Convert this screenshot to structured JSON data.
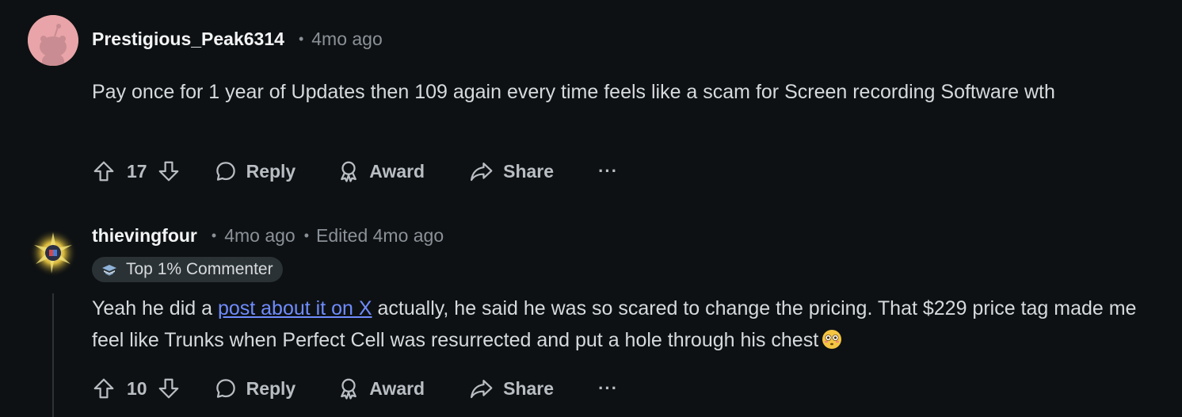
{
  "comments": [
    {
      "username": "Prestigious_Peak6314",
      "time": "4mo ago",
      "body": "Pay once for 1 year of Updates then 109 again every time feels like a scam for Screen recording Software wth",
      "votes": "17",
      "actions": {
        "reply": "Reply",
        "award": "Award",
        "share": "Share",
        "more": "···"
      },
      "avatar_color": "#e8a4a8"
    },
    {
      "username": "thievingfour",
      "time": "4mo ago",
      "edited": "Edited 4mo ago",
      "badge": "Top 1% Commenter",
      "body_pre": "Yeah he did a ",
      "body_link": "post about it on X",
      "body_post": " actually, he said he was so scared to change the pricing. That $229 price tag made me feel like Trunks when Perfect Cell was resurrected and put a hole through his chest",
      "votes": "10",
      "actions": {
        "reply": "Reply",
        "award": "Award",
        "share": "Share",
        "more": "···"
      },
      "link_color": "#6f8cff"
    }
  ],
  "colors": {
    "background": "#0e1113",
    "text": "#d7dadc",
    "muted": "#8a9198"
  },
  "icons": [
    "upvote-icon",
    "downvote-icon",
    "reply-icon",
    "award-icon",
    "share-icon",
    "more-icon",
    "flushed-emoji-icon",
    "commenter-badge-icon"
  ]
}
